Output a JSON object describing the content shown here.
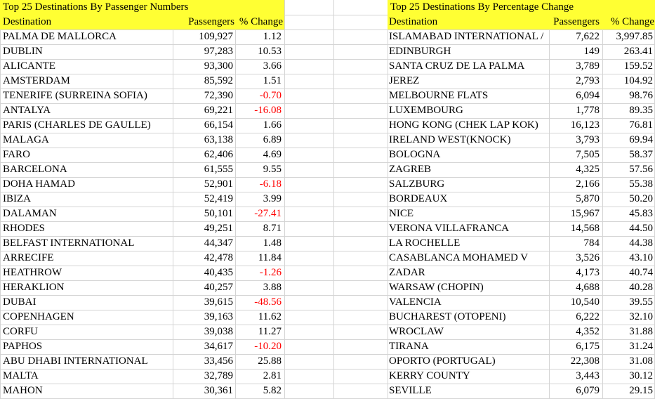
{
  "left_table": {
    "title": "Top 25 Destinations By Passenger Numbers",
    "headers": {
      "destination": "Destination",
      "passengers": "Passengers",
      "change": "% Change"
    },
    "rows": [
      {
        "destination": "PALMA DE MALLORCA",
        "passengers": "109,927",
        "change": "1.12"
      },
      {
        "destination": "DUBLIN",
        "passengers": "97,283",
        "change": "10.53"
      },
      {
        "destination": "ALICANTE",
        "passengers": "93,300",
        "change": "3.66"
      },
      {
        "destination": "AMSTERDAM",
        "passengers": "85,592",
        "change": "1.51"
      },
      {
        "destination": "TENERIFE (SURREINA SOFIA)",
        "passengers": "72,390",
        "change": "-0.70"
      },
      {
        "destination": "ANTALYA",
        "passengers": "69,221",
        "change": "-16.08"
      },
      {
        "destination": "PARIS (CHARLES DE GAULLE)",
        "passengers": "66,154",
        "change": "1.66"
      },
      {
        "destination": "MALAGA",
        "passengers": "63,138",
        "change": "6.89"
      },
      {
        "destination": "FARO",
        "passengers": "62,406",
        "change": "4.69"
      },
      {
        "destination": "BARCELONA",
        "passengers": "61,555",
        "change": "9.55"
      },
      {
        "destination": "DOHA HAMAD",
        "passengers": "52,901",
        "change": "-6.18"
      },
      {
        "destination": "IBIZA",
        "passengers": "52,419",
        "change": "3.99"
      },
      {
        "destination": "DALAMAN",
        "passengers": "50,101",
        "change": "-27.41"
      },
      {
        "destination": "RHODES",
        "passengers": "49,251",
        "change": "8.71"
      },
      {
        "destination": "BELFAST INTERNATIONAL",
        "passengers": "44,347",
        "change": "1.48"
      },
      {
        "destination": "ARRECIFE",
        "passengers": "42,478",
        "change": "11.84"
      },
      {
        "destination": "HEATHROW",
        "passengers": "40,435",
        "change": "-1.26"
      },
      {
        "destination": "HERAKLION",
        "passengers": "40,257",
        "change": "3.88"
      },
      {
        "destination": "DUBAI",
        "passengers": "39,615",
        "change": "-48.56"
      },
      {
        "destination": "COPENHAGEN",
        "passengers": "39,163",
        "change": "11.62"
      },
      {
        "destination": "CORFU",
        "passengers": "39,038",
        "change": "11.27"
      },
      {
        "destination": "PAPHOS",
        "passengers": "34,617",
        "change": "-10.20"
      },
      {
        "destination": "ABU DHABI INTERNATIONAL",
        "passengers": "33,456",
        "change": "25.88"
      },
      {
        "destination": "MALTA",
        "passengers": "32,789",
        "change": "2.81"
      },
      {
        "destination": "MAHON",
        "passengers": "30,361",
        "change": "5.82"
      }
    ]
  },
  "right_table": {
    "title": "Top 25 Destinations By Percentage Change",
    "headers": {
      "destination": "Destination",
      "passengers": "Passengers",
      "change": "% Change"
    },
    "rows": [
      {
        "destination": "ISLAMABAD INTERNATIONAL /",
        "passengers": "7,622",
        "change": "3,997.85"
      },
      {
        "destination": "EDINBURGH",
        "passengers": "149",
        "change": "263.41"
      },
      {
        "destination": "SANTA CRUZ DE LA PALMA",
        "passengers": "3,789",
        "change": "159.52"
      },
      {
        "destination": "JEREZ",
        "passengers": "2,793",
        "change": "104.92"
      },
      {
        "destination": "MELBOURNE FLATS",
        "passengers": "6,094",
        "change": "98.76"
      },
      {
        "destination": "LUXEMBOURG",
        "passengers": "1,778",
        "change": "89.35"
      },
      {
        "destination": "HONG KONG (CHEK LAP KOK)",
        "passengers": "16,123",
        "change": "76.81"
      },
      {
        "destination": "IRELAND WEST(KNOCK)",
        "passengers": "3,793",
        "change": "69.94"
      },
      {
        "destination": "BOLOGNA",
        "passengers": "7,505",
        "change": "58.37"
      },
      {
        "destination": "ZAGREB",
        "passengers": "4,325",
        "change": "57.56"
      },
      {
        "destination": "SALZBURG",
        "passengers": "2,166",
        "change": "55.38"
      },
      {
        "destination": "BORDEAUX",
        "passengers": "5,870",
        "change": "50.20"
      },
      {
        "destination": "NICE",
        "passengers": "15,967",
        "change": "45.83"
      },
      {
        "destination": "VERONA VILLAFRANCA",
        "passengers": "14,568",
        "change": "44.50"
      },
      {
        "destination": "LA ROCHELLE",
        "passengers": "784",
        "change": "44.38"
      },
      {
        "destination": "CASABLANCA MOHAMED V",
        "passengers": "3,526",
        "change": "43.10"
      },
      {
        "destination": "ZADAR",
        "passengers": "4,173",
        "change": "40.74"
      },
      {
        "destination": "WARSAW (CHOPIN)",
        "passengers": "4,688",
        "change": "40.28"
      },
      {
        "destination": "VALENCIA",
        "passengers": "10,540",
        "change": "39.55"
      },
      {
        "destination": "BUCHAREST (OTOPENI)",
        "passengers": "6,222",
        "change": "32.10"
      },
      {
        "destination": "WROCLAW",
        "passengers": "4,352",
        "change": "31.88"
      },
      {
        "destination": "TIRANA",
        "passengers": "6,175",
        "change": "31.24"
      },
      {
        "destination": "OPORTO (PORTUGAL)",
        "passengers": "22,308",
        "change": "31.08"
      },
      {
        "destination": "KERRY COUNTY",
        "passengers": "3,443",
        "change": "30.12"
      },
      {
        "destination": "SEVILLE",
        "passengers": "6,079",
        "change": "29.15"
      }
    ]
  },
  "colors": {
    "header_fill": "#ffff33",
    "negative_text": "#ff0000",
    "gridline": "#d4d4d4"
  }
}
